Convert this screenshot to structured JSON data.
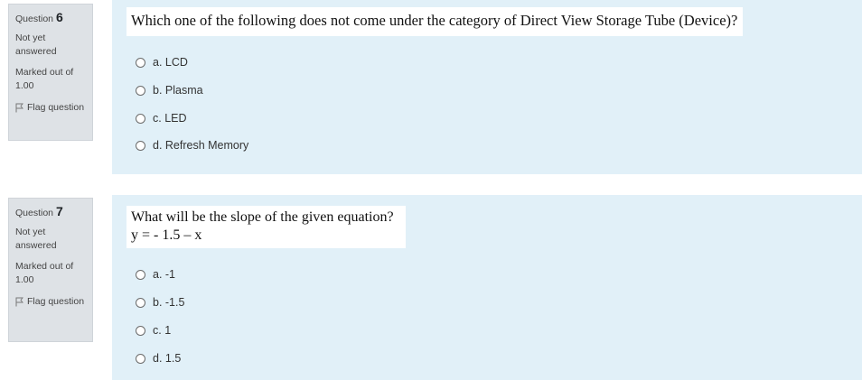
{
  "questions": [
    {
      "label": "Question",
      "number": "6",
      "state": "Not yet answered",
      "grade": "Marked out of 1.00",
      "flag_label": "Flag question",
      "text_lines": [
        "Which one of the following does not come under the category of Direct View Storage Tube (Device)?"
      ],
      "answers": [
        "a. LCD",
        "b. Plasma",
        "c. LED",
        "d. Refresh Memory"
      ]
    },
    {
      "label": "Question",
      "number": "7",
      "state": "Not yet answered",
      "grade": "Marked out of 1.00",
      "flag_label": "Flag question",
      "text_lines": [
        "What will be the slope of the given equation?",
        "y = - 1.5 – x"
      ],
      "answers": [
        "a. -1",
        "b. -1.5",
        "c. 1",
        "d. 1.5"
      ]
    }
  ],
  "icons": {
    "flag": "flag-icon",
    "radio": "radio-button"
  }
}
